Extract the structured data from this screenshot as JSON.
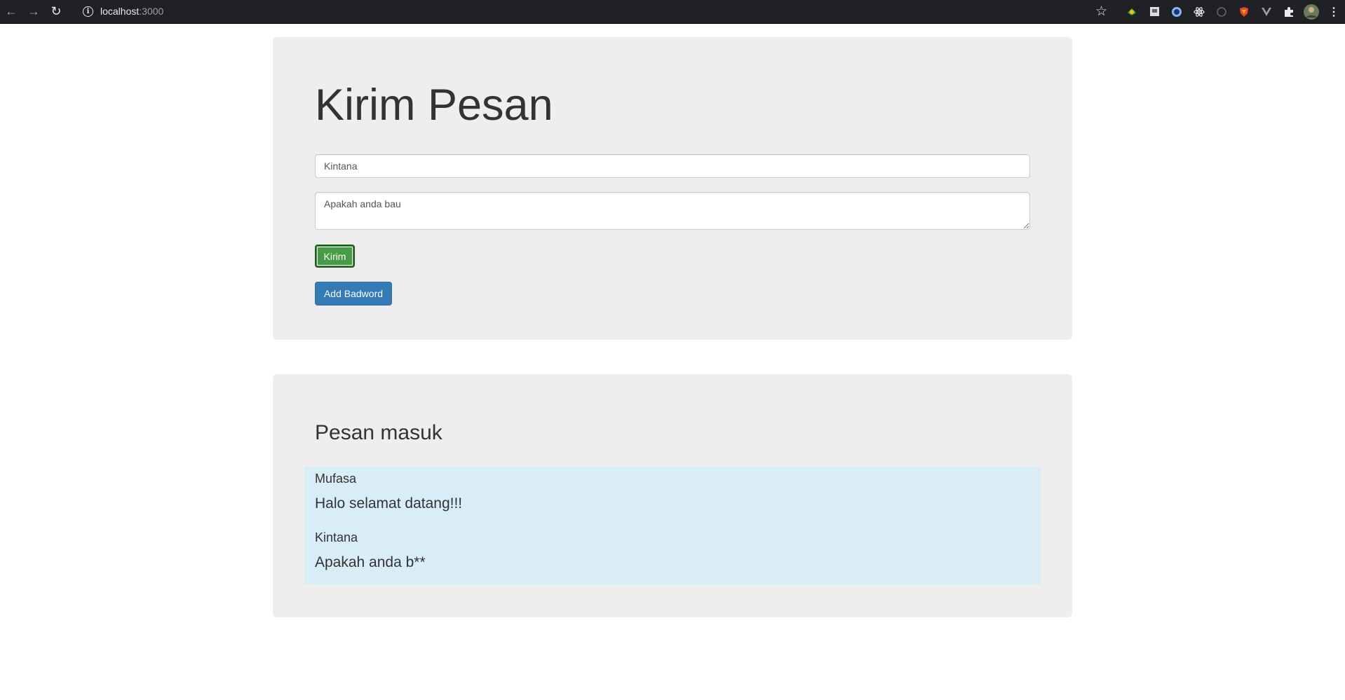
{
  "browser": {
    "url_host": "localhost",
    "url_port": ":3000"
  },
  "compose": {
    "title": "Kirim Pesan",
    "name_value": "Kintana",
    "message_value": "Apakah anda bau",
    "send_label": "Kirim",
    "badword_label": "Add Badword"
  },
  "inbox": {
    "title": "Pesan masuk",
    "messages": [
      {
        "sender": "Mufasa",
        "text": "Halo selamat datang!!!"
      },
      {
        "sender": "Kintana",
        "text": "Apakah anda b**"
      }
    ]
  },
  "colors": {
    "send_button": "#449d44",
    "badword_button": "#337ab7",
    "message_list_bg": "#d9edf7",
    "panel_bg": "#eeeeee"
  }
}
